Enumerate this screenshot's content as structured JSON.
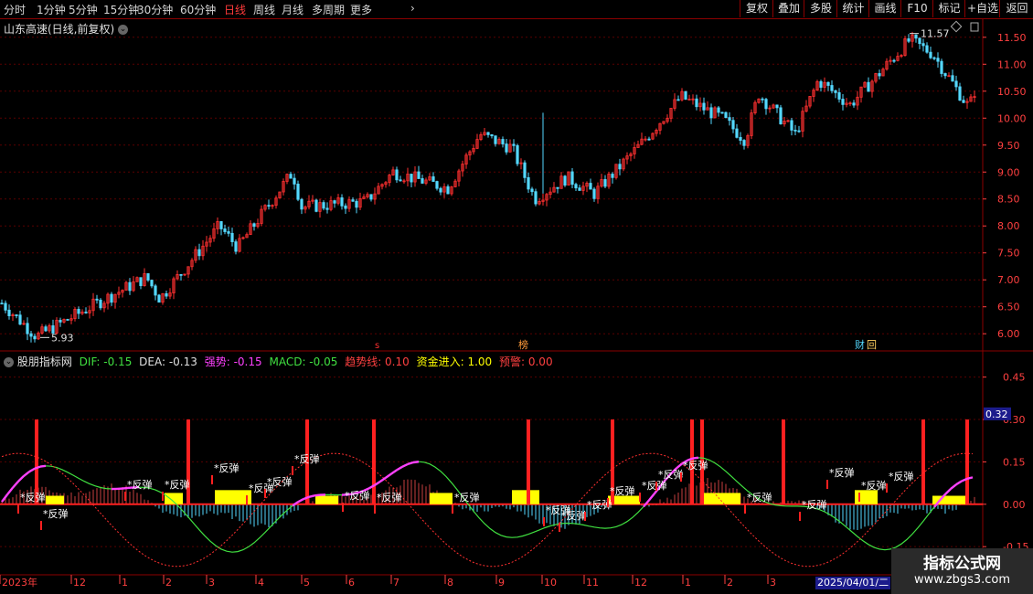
{
  "toolbar": {
    "periods": [
      "分时",
      "1分钟",
      "5分钟",
      "15分钟",
      "30分钟",
      "60分钟",
      "日线",
      "周线",
      "月线",
      "多周期",
      "更多"
    ],
    "active_period": "日线",
    "buttons": [
      "复权",
      "叠加",
      "多股",
      "统计",
      "画线",
      "F10",
      "标记",
      "+自选",
      "返回"
    ]
  },
  "price_chart": {
    "title": "山东高速(日线,前复权)",
    "y_axis": [
      "11.50",
      "11.00",
      "10.50",
      "10.00",
      "9.50",
      "9.00",
      "8.50",
      "8.00",
      "7.50",
      "7.00",
      "6.50",
      "6.00"
    ],
    "ylim": [
      5.8,
      11.7
    ],
    "high_label": "11.57",
    "low_label": "5.93",
    "markers": [
      "榜",
      "财|回"
    ]
  },
  "indicator": {
    "name": "股朋指标网",
    "dif_label": "DIF: -0.15",
    "dea_label": "DEA: -0.13",
    "strong_label": "强势: -0.15",
    "macd_label": "MACD: -0.05",
    "trend_label": "趋势线: 0.10",
    "fund_label": "资金进入: 1.00",
    "warn_label": "预警: 0.00",
    "y_axis": [
      "0.45",
      "0.30",
      "0.15",
      "0.00",
      "-0.15"
    ],
    "current_value": "0.32",
    "rebound_label": "*反弹",
    "colors": {
      "dif": "#40e040",
      "dea": "#ff4040",
      "strong": "#ff40ff",
      "macd": "#ff40ff",
      "trend": "#ff4040",
      "fund": "#ffff00",
      "warn": "#ff4040"
    }
  },
  "x_axis": {
    "labels": [
      "2023年",
      "12",
      "1",
      "2",
      "3",
      "4",
      "5",
      "6",
      "7",
      "8",
      "9",
      "10",
      "11",
      "12",
      "1",
      "2",
      "3"
    ],
    "cursor_date": "2025/04/01/二"
  },
  "watermark": {
    "line1": "指标公式网",
    "line2": "www.zbgs3.com"
  }
}
